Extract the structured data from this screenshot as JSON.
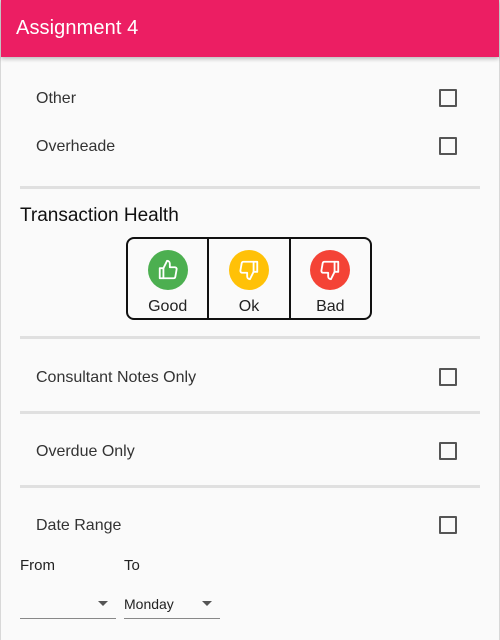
{
  "appbar": {
    "title": "Assignment 4",
    "color": "#ec1e63"
  },
  "filters": {
    "other_label": "Other",
    "overhead_label": "Overheade",
    "consultant_notes_label": "Consultant Notes Only",
    "overdue_label": "Overdue Only",
    "date_range_label": "Date Range"
  },
  "transaction_health": {
    "title": "Transaction Health",
    "options": [
      {
        "label": "Good",
        "icon": "thumbs-up-icon",
        "color": "#4caf50"
      },
      {
        "label": "Ok",
        "icon": "thumbs-down-icon",
        "color": "#ffc107"
      },
      {
        "label": "Bad",
        "icon": "thumbs-down-icon",
        "color": "#f44336"
      }
    ]
  },
  "date_range": {
    "from_label": "From",
    "to_label": "To",
    "from_value": "",
    "to_value": "Monday"
  }
}
